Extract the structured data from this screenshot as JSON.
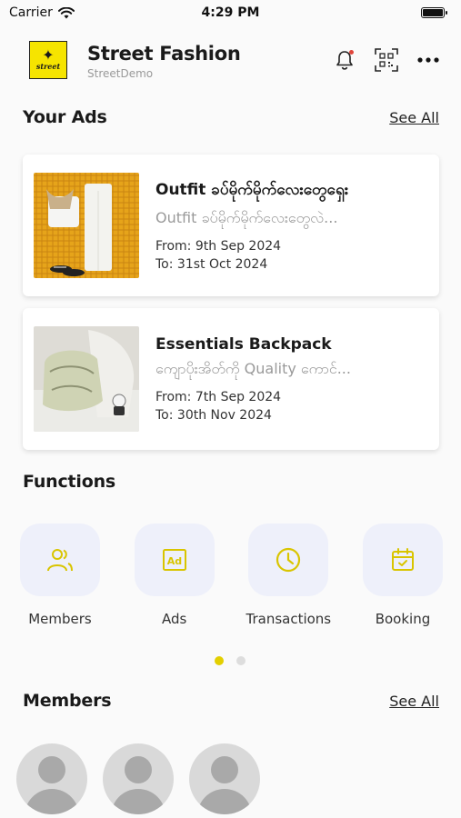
{
  "status_bar": {
    "carrier": "Carrier",
    "time": "4:29 PM"
  },
  "header": {
    "logo_text": "street",
    "title": "Street Fashion",
    "subtitle": "StreetDemo",
    "icons": [
      "bell-icon",
      "qr-scan-icon",
      "more-icon"
    ]
  },
  "your_ads": {
    "title": "Your Ads",
    "see_all": "See All",
    "items": [
      {
        "title": "Outfit ခပ်မိုက်မိုက်လေးတွေရှေး",
        "description": "Outfit ခပ်မိုက်မိုက်လေးတွေလဲ...",
        "from": "From: 9th Sep 2024",
        "to": "To: 31st Oct 2024"
      },
      {
        "title": "Essentials Backpack",
        "description": "ကျောပိုးအိတ်ကို Quality ကောင်...",
        "from": "From: 7th Sep 2024",
        "to": "To: 30th Nov 2024"
      }
    ]
  },
  "functions": {
    "title": "Functions",
    "items": [
      {
        "label": "Members",
        "icon": "users-icon"
      },
      {
        "label": "Ads",
        "icon": "ad-icon"
      },
      {
        "label": "Transactions",
        "icon": "clock-icon"
      },
      {
        "label": "Booking",
        "icon": "calendar-check-icon"
      }
    ],
    "pager": {
      "pages": 2,
      "active": 1
    }
  },
  "members": {
    "title": "Members",
    "see_all": "See All",
    "count_visible": 3
  },
  "colors": {
    "accent": "#e3cf00",
    "tile_bg": "#eef0fa",
    "notification_dot": "#e0453b",
    "logo_yellow": "#f6e400"
  }
}
